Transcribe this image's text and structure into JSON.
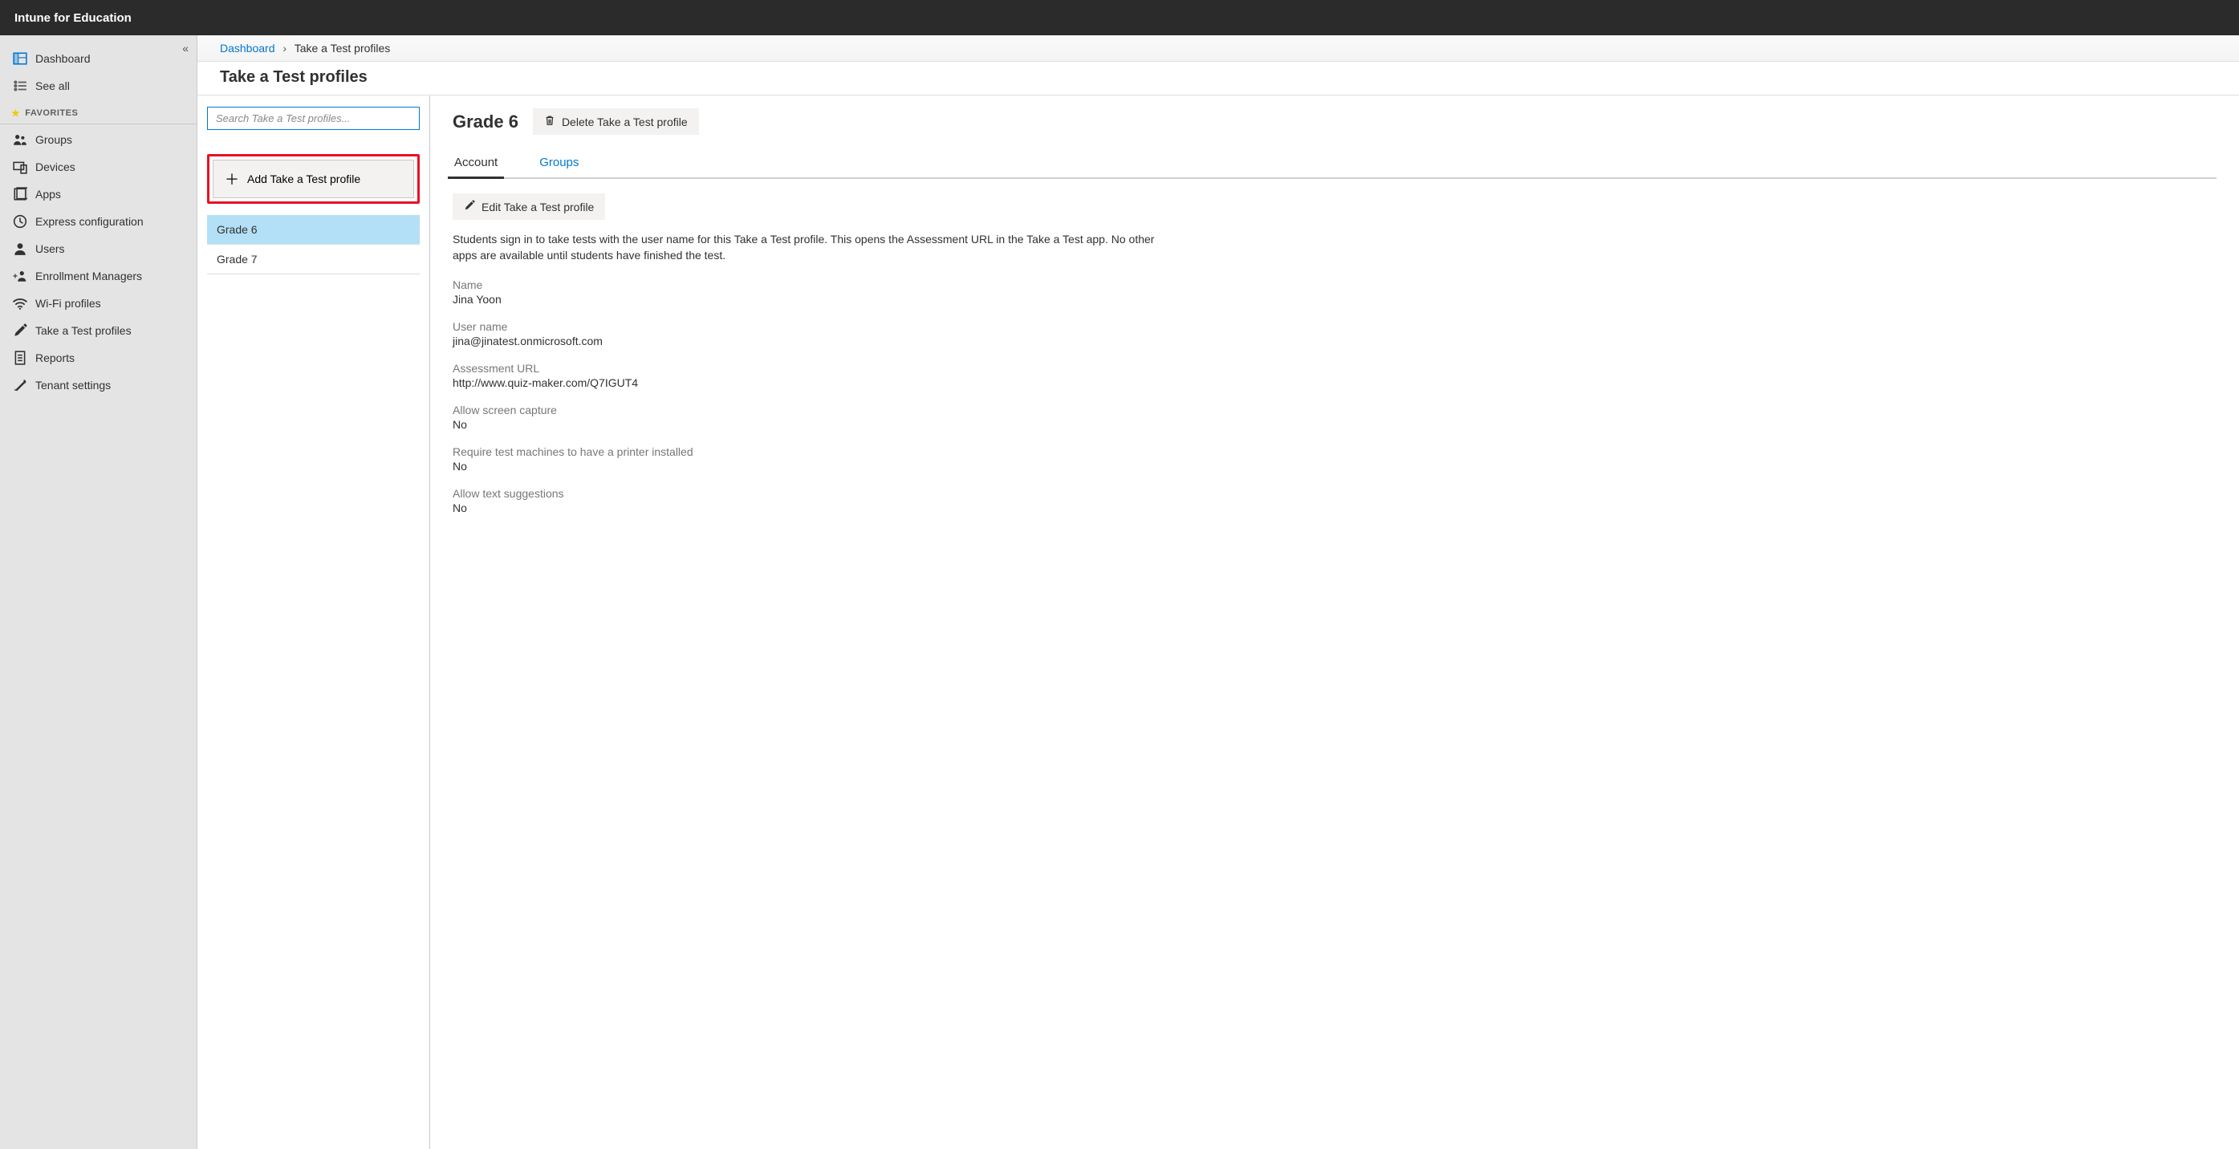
{
  "app_title": "Intune for Education",
  "sidebar": {
    "top": [
      {
        "label": "Dashboard",
        "icon": "dashboard"
      },
      {
        "label": "See all",
        "icon": "list"
      }
    ],
    "favorites_header": "FAVORITES",
    "favorites": [
      {
        "label": "Groups",
        "icon": "groups"
      },
      {
        "label": "Devices",
        "icon": "devices"
      },
      {
        "label": "Apps",
        "icon": "apps"
      },
      {
        "label": "Express configuration",
        "icon": "clock"
      },
      {
        "label": "Users",
        "icon": "user"
      },
      {
        "label": "Enrollment Managers",
        "icon": "enroll"
      },
      {
        "label": "Wi-Fi profiles",
        "icon": "wifi"
      },
      {
        "label": "Take a Test profiles",
        "icon": "pencil"
      },
      {
        "label": "Reports",
        "icon": "report"
      },
      {
        "label": "Tenant settings",
        "icon": "tools"
      }
    ]
  },
  "breadcrumb": {
    "root": "Dashboard",
    "current": "Take a Test profiles"
  },
  "page_title": "Take a Test profiles",
  "search_placeholder": "Search Take a Test profiles...",
  "add_button": "Add Take a Test profile",
  "profiles": [
    {
      "name": "Grade 6",
      "selected": true
    },
    {
      "name": "Grade 7",
      "selected": false
    }
  ],
  "detail": {
    "title": "Grade 6",
    "delete_label": "Delete Take a Test profile",
    "tabs": [
      {
        "label": "Account",
        "active": true
      },
      {
        "label": "Groups",
        "active": false
      }
    ],
    "edit_label": "Edit Take a Test profile",
    "description": "Students sign in to take tests with the user name for this Take a Test profile. This opens the Assessment URL in the Take a Test app. No other apps are available until students have finished the test.",
    "fields": [
      {
        "label": "Name",
        "value": "Jina Yoon"
      },
      {
        "label": "User name",
        "value": "jina@jinatest.onmicrosoft.com"
      },
      {
        "label": "Assessment URL",
        "value": "http://www.quiz-maker.com/Q7IGUT4"
      },
      {
        "label": "Allow screen capture",
        "value": "No"
      },
      {
        "label": "Require test machines to have a printer installed",
        "value": "No"
      },
      {
        "label": "Allow text suggestions",
        "value": "No"
      }
    ]
  }
}
